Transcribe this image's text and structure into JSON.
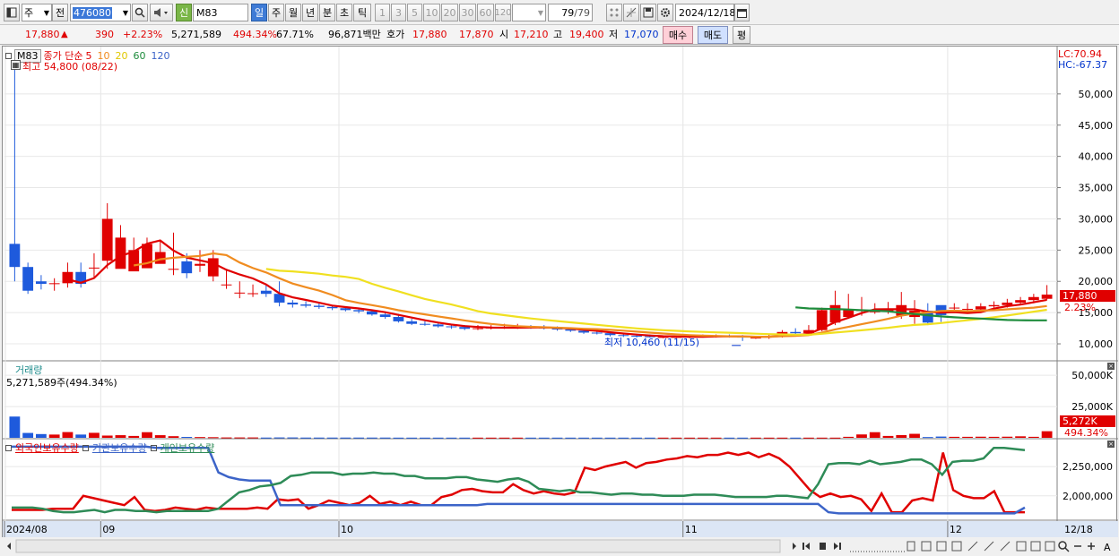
{
  "toolbar": {
    "mode_label": "주",
    "prev_label": "전",
    "code_value": "476080",
    "sin_badge": "신",
    "stock_name": "M83",
    "periods": [
      "일",
      "주",
      "월",
      "년",
      "분",
      "초",
      "틱"
    ],
    "minutes": [
      "1",
      "3",
      "5",
      "10",
      "20",
      "30",
      "60",
      "120"
    ],
    "count_value": "79",
    "count_total": "/79",
    "date_value": "2024/12/18"
  },
  "quote": {
    "price": "17,880",
    "arrow": "▲",
    "change": "390",
    "change_pct": "+2.23%",
    "volume": "5,271,589",
    "volume_ratio": "494.34%",
    "turnover": "67.71%",
    "amount": "96,871백만",
    "hoga_label": "호가",
    "ask": "17,880",
    "bid": "17,870",
    "open_label": "시",
    "open": "17,210",
    "high_label": "고",
    "high": "19,400",
    "low_label": "저",
    "low": "17,070",
    "buy_label": "매수",
    "sell_label": "매도",
    "avg_label": "평"
  },
  "price_panel": {
    "legend_name": "M83",
    "legend_ma_label": "종가 단순",
    "ma_periods": [
      "5",
      "10",
      "20",
      "60",
      "120"
    ],
    "ma_colors": [
      "#e00000",
      "#f08c20",
      "#f0e020",
      "#1e8c3c",
      "#3c64c8"
    ],
    "max_annotation": "최고 54,800 (08/22)",
    "min_annotation": "최저 10,460 (11/15)",
    "lc_label": "LC:70.94",
    "hc_label": "HC:-67.37",
    "y_ticks": [
      "50,000",
      "45,000",
      "40,000",
      "35,000",
      "30,000",
      "25,000",
      "20,000",
      "15,000",
      "10,000"
    ],
    "current_price_tag": "17,880",
    "current_pct_tag": "2.23%"
  },
  "volume_panel": {
    "title": "거래량",
    "value_label": "5,271,589주(494.34%)",
    "y_ticks": [
      "50,000K",
      "25,000K"
    ],
    "current_tag": "5,272K",
    "current_pct": "494.34%"
  },
  "holding_panel": {
    "series_labels": [
      "외국인보유수량",
      "기관보유수량",
      "개인보유수량"
    ],
    "colors": [
      "#e00000",
      "#3c64c8",
      "#2e8b57"
    ],
    "y_ticks": [
      "2,250,000",
      "2,000,000"
    ]
  },
  "x_axis": {
    "labels": [
      "2024/08",
      "09",
      "10",
      "11",
      "12",
      "12/18"
    ]
  },
  "chart_data": [
    {
      "type": "candlestick",
      "title": "M83",
      "x": [
        "08/22",
        "08/23",
        "08/26",
        "08/27",
        "08/28",
        "08/29",
        "08/30",
        "09/02",
        "09/03",
        "09/04",
        "09/05",
        "09/06",
        "09/09",
        "09/10",
        "09/11",
        "09/12",
        "09/13",
        "09/19",
        "09/20",
        "09/23",
        "09/24",
        "09/25",
        "09/26",
        "09/27",
        "09/30",
        "10/02",
        "10/04",
        "10/07",
        "10/08",
        "10/10",
        "10/11",
        "10/14",
        "10/15",
        "10/16",
        "10/17",
        "10/18",
        "10/21",
        "10/22",
        "10/23",
        "10/24",
        "10/25",
        "10/28",
        "10/29",
        "10/30",
        "10/31",
        "11/01",
        "11/04",
        "11/05",
        "11/06",
        "11/07",
        "11/08",
        "11/11",
        "11/12",
        "11/13",
        "11/14",
        "11/15",
        "11/18",
        "11/19",
        "11/20",
        "11/21",
        "11/22",
        "11/25",
        "11/26",
        "11/27",
        "11/28",
        "11/29",
        "12/02",
        "12/03",
        "12/04",
        "12/05",
        "12/06",
        "12/09",
        "12/10",
        "12/11",
        "12/12",
        "12/13",
        "12/16",
        "12/17",
        "12/18"
      ],
      "open": [
        26000,
        22300,
        20000,
        19600,
        19700,
        21500,
        22200,
        23300,
        22000,
        21600,
        22100,
        22800,
        22000,
        23200,
        22500,
        20800,
        19500,
        18200,
        18100,
        18500,
        18000,
        16600,
        16300,
        16100,
        15900,
        15700,
        15400,
        15200,
        14700,
        14300,
        13600,
        13200,
        13100,
        12800,
        12700,
        12400,
        12500,
        12600,
        12700,
        12700,
        12600,
        12500,
        12300,
        12100,
        11800,
        11700,
        11400,
        11300,
        11200,
        11100,
        11100,
        11100,
        11200,
        11200,
        11300,
        11200,
        11000,
        11000,
        11200,
        11900,
        11700,
        12200,
        13400,
        14300,
        15400,
        15200,
        15200,
        14500,
        14300,
        15300,
        16200,
        15800,
        15600,
        15500,
        16000,
        16200,
        16600,
        17000,
        17210
      ],
      "close": [
        22300,
        18500,
        19600,
        19700,
        21500,
        19600,
        22200,
        30000,
        27000,
        25000,
        26000,
        24700,
        22000,
        21300,
        22800,
        23700,
        19500,
        18200,
        18100,
        18000,
        16600,
        16300,
        16100,
        15900,
        15700,
        15400,
        15200,
        14700,
        14300,
        13600,
        13200,
        13100,
        12800,
        12700,
        12400,
        12500,
        12600,
        12700,
        12700,
        12600,
        12500,
        12300,
        12100,
        11800,
        11700,
        11400,
        11300,
        11200,
        11100,
        11100,
        11100,
        11200,
        11200,
        11300,
        11200,
        11000,
        11000,
        11200,
        11900,
        11700,
        12200,
        15400,
        16200,
        15400,
        15400,
        15200,
        15500,
        16200,
        15300,
        13400,
        14600,
        15800,
        15600,
        16000,
        16200,
        16600,
        17000,
        17490,
        17880
      ],
      "high": [
        54800,
        23000,
        21000,
        20500,
        23000,
        23000,
        24500,
        32500,
        29000,
        27000,
        27000,
        26500,
        27800,
        24500,
        25000,
        25000,
        22000,
        20000,
        19500,
        19500,
        20000,
        17000,
        16800,
        16500,
        16200,
        16000,
        15800,
        15500,
        15000,
        14800,
        14000,
        13600,
        13500,
        13200,
        13000,
        13000,
        13000,
        13200,
        13200,
        13000,
        13000,
        12800,
        12600,
        12300,
        12000,
        12000,
        11700,
        11600,
        11500,
        11300,
        11300,
        11400,
        11500,
        11500,
        11500,
        11400,
        11300,
        11500,
        12200,
        12500,
        13000,
        15800,
        18500,
        18000,
        17500,
        16500,
        16700,
        18300,
        17000,
        16500,
        15500,
        16500,
        16500,
        16500,
        16800,
        17200,
        17500,
        18000,
        19400
      ],
      "low": [
        20000,
        18000,
        18700,
        18500,
        19000,
        19000,
        20500,
        22000,
        24500,
        23500,
        25000,
        23000,
        21000,
        20500,
        21500,
        20000,
        18800,
        17300,
        17500,
        17500,
        16000,
        15800,
        15800,
        15600,
        15400,
        15200,
        14900,
        14500,
        14000,
        13400,
        13000,
        12900,
        12600,
        12400,
        12200,
        12200,
        12300,
        12400,
        12400,
        12400,
        12300,
        12100,
        11900,
        11600,
        11500,
        11200,
        11100,
        11000,
        11000,
        10900,
        10900,
        10900,
        11000,
        11000,
        11000,
        10460,
        10800,
        10800,
        11000,
        11500,
        11500,
        12000,
        13000,
        14000,
        14500,
        14800,
        14800,
        14000,
        13200,
        13000,
        13500,
        15000,
        15000,
        15200,
        15600,
        15800,
        16200,
        16500,
        17070
      ],
      "ylim": [
        8000,
        57000
      ],
      "y_ticks": [
        10000,
        15000,
        20000,
        25000,
        30000,
        35000,
        40000,
        45000,
        50000
      ]
    },
    {
      "type": "bar",
      "title": "거래량",
      "unit": "K",
      "values": [
        17000,
        3900,
        3000,
        2600,
        4600,
        2600,
        4000,
        1800,
        2100,
        1500,
        4500,
        2100,
        1300,
        700,
        600,
        500,
        300,
        300,
        300,
        200,
        300,
        300,
        200,
        200,
        200,
        200,
        200,
        200,
        200,
        150,
        150,
        150,
        150,
        150,
        150,
        150,
        150,
        150,
        150,
        150,
        150,
        150,
        150,
        150,
        150,
        150,
        150,
        150,
        150,
        150,
        150,
        150,
        150,
        150,
        150,
        150,
        150,
        150,
        150,
        150,
        150,
        150,
        150,
        800,
        2700,
        4500,
        1500,
        2200,
        3200,
        600,
        1000,
        800,
        800,
        900,
        800,
        900,
        1200,
        800,
        5272
      ],
      "ylim": [
        0,
        58000
      ],
      "y_ticks": [
        25000,
        50000
      ]
    },
    {
      "type": "line",
      "title": "보유수량",
      "series": [
        {
          "name": "외국인보유수량",
          "values": [
            1880000,
            1880000,
            1880000,
            1880000,
            1890000,
            1890000,
            1890000,
            2000000,
            1980000,
            1960000,
            1940000,
            1920000,
            1990000,
            1880000,
            1870000,
            1880000,
            1900000,
            1890000,
            1880000,
            1900000,
            1890000,
            1890000,
            1890000,
            1890000,
            1900000,
            1890000,
            1970000,
            1960000,
            1970000,
            1890000,
            1920000,
            1960000,
            1940000,
            1920000,
            1940000,
            2000000,
            1930000,
            1950000,
            1920000,
            1950000,
            1920000,
            1920000,
            1990000,
            2010000,
            2050000,
            2060000,
            2040000,
            2030000,
            2030000,
            2100000,
            2050000,
            2020000,
            2040000,
            2020000,
            2010000,
            2030000,
            2240000,
            2220000,
            2250000,
            2270000,
            2290000,
            2240000,
            2280000,
            2290000,
            2310000,
            2320000,
            2340000,
            2330000,
            2350000,
            2350000,
            2370000,
            2350000,
            2370000,
            2330000,
            2360000,
            2320000,
            2250000,
            2150000,
            2050000,
            1990000,
            2020000,
            1990000,
            2000000,
            1970000,
            1870000,
            2020000,
            1860000,
            1860000,
            1960000,
            1980000,
            1960000,
            2370000,
            2050000,
            2000000,
            1980000,
            1980000,
            2040000,
            1860000,
            1860000,
            1860000
          ]
        },
        {
          "name": "기관보유수량",
          "values": [
            2420000,
            2420000,
            2420000,
            2420000,
            2420000,
            2420000,
            2420000,
            2420000,
            2420000,
            2420000,
            2420000,
            2420000,
            2420000,
            2420000,
            2410000,
            2410000,
            2410000,
            2410000,
            2410000,
            2410000,
            2200000,
            2160000,
            2140000,
            2130000,
            2130000,
            2130000,
            1920000,
            1920000,
            1920000,
            1920000,
            1920000,
            1920000,
            1920000,
            1920000,
            1920000,
            1920000,
            1920000,
            1920000,
            1920000,
            1920000,
            1920000,
            1920000,
            1920000,
            1920000,
            1920000,
            1920000,
            1930000,
            1930000,
            1930000,
            1930000,
            1930000,
            1930000,
            1930000,
            1930000,
            1930000,
            1930000,
            1930000,
            1930000,
            1930000,
            1930000,
            1930000,
            1930000,
            1930000,
            1930000,
            1930000,
            1930000,
            1930000,
            1930000,
            1930000,
            1930000,
            1930000,
            1930000,
            1930000,
            1930000,
            1930000,
            1930000,
            1930000,
            1930000,
            1930000,
            1860000,
            1850000,
            1850000,
            1850000,
            1850000,
            1850000,
            1850000,
            1850000,
            1850000,
            1850000,
            1850000,
            1850000,
            1850000,
            1850000,
            1850000,
            1850000,
            1850000,
            1850000,
            1850000,
            1900000
          ]
        },
        {
          "name": "개인보유수량",
          "values": [
            1900000,
            1900000,
            1900000,
            1890000,
            1870000,
            1860000,
            1860000,
            1870000,
            1880000,
            1860000,
            1880000,
            1880000,
            1870000,
            1870000,
            1860000,
            1870000,
            1870000,
            1870000,
            1870000,
            1870000,
            1890000,
            1960000,
            2030000,
            2050000,
            2080000,
            2090000,
            2110000,
            2170000,
            2180000,
            2200000,
            2200000,
            2200000,
            2180000,
            2190000,
            2190000,
            2200000,
            2190000,
            2190000,
            2170000,
            2170000,
            2150000,
            2150000,
            2150000,
            2160000,
            2160000,
            2140000,
            2130000,
            2120000,
            2140000,
            2150000,
            2120000,
            2060000,
            2050000,
            2040000,
            2050000,
            2030000,
            2030000,
            2020000,
            2010000,
            2020000,
            2020000,
            2010000,
            2010000,
            2000000,
            2000000,
            2000000,
            2010000,
            2010000,
            2010000,
            2000000,
            1990000,
            1990000,
            1990000,
            1990000,
            2000000,
            2000000,
            1990000,
            1980000,
            2100000,
            2270000,
            2280000,
            2280000,
            2270000,
            2300000,
            2270000,
            2280000,
            2290000,
            2310000,
            2310000,
            2270000,
            2180000,
            2290000,
            2300000,
            2300000,
            2320000,
            2410000,
            2410000,
            2400000,
            2390000
          ]
        }
      ],
      "ylim": [
        1830000,
        2450000
      ],
      "y_ticks": [
        2000000,
        2250000
      ]
    }
  ]
}
